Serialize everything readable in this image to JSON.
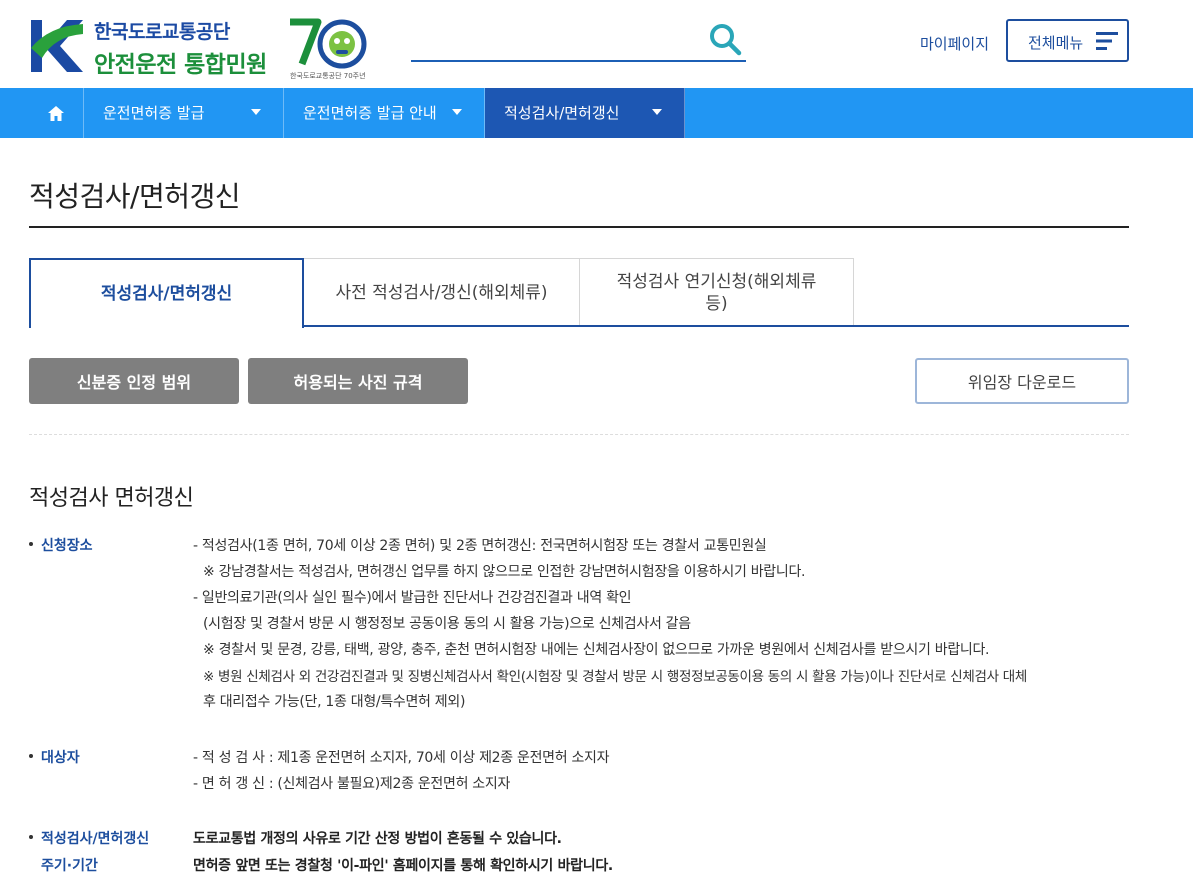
{
  "header": {
    "org_name": "한국도로교통공단",
    "site_name": "안전운전 통합민원",
    "anniversary_caption": "한국도로교통공단 70주년",
    "search_placeholder": "",
    "mypage_label": "마이페이지",
    "allmenu_label": "전체메뉴"
  },
  "nav": {
    "items": [
      {
        "label": "운전면허증 발급"
      },
      {
        "label": "운전면허증 발급 안내"
      },
      {
        "label": "적성검사/면허갱신"
      }
    ]
  },
  "page": {
    "title": "적성검사/면허갱신",
    "tabs": [
      {
        "label": "적성검사/면허갱신"
      },
      {
        "label": "사전 적성검사/갱신(해외체류)"
      },
      {
        "label_line1": "적성검사 연기신청(해외체류",
        "label_line2": "등)"
      }
    ],
    "buttons": {
      "id_scope": "신분증 인정 범위",
      "photo_spec": "허용되는 사진 규격",
      "proxy_download": "위임장 다운로드"
    }
  },
  "section": {
    "title": "적성검사 면허갱신",
    "place": {
      "label": "신청장소",
      "lines": [
        "- 적성검사(1종 면허, 70세 이상 2종 면허) 및 2종 면허갱신: 전국면허시험장 또는 경찰서 교통민원실",
        "※ 강남경찰서는 적성검사, 면허갱신 업무를 하지 않으므로 인접한 강남면허시험장을 이용하시기 바랍니다.",
        "- 일반의료기관(의사 실인 필수)에서 발급한 진단서나 건강검진결과 내역 확인",
        "(시험장 및 경찰서 방문 시 행정정보 공동이용 동의 시 활용 가능)으로 신체검사서 갈음",
        "※ 경찰서 및 문경, 강릉, 태백, 광양, 충주, 춘천 면허시험장 내에는 신체검사장이 없으므로 가까운 병원에서 신체검사를 받으시기 바랍니다.",
        "※ 병원 신체검사 외 건강검진결과 및 징병신체검사서 확인(시험장 및 경찰서 방문 시 행정정보공동이용 동의 시 활용 가능)이나 진단서로 신체검사 대체",
        "후 대리접수 가능(단, 1종 대형/특수면허 제외)"
      ]
    },
    "target": {
      "label": "대상자",
      "lines": [
        "- 적 성 검 사 : 제1종 운전면허 소지자, 70세 이상 제2종 운전면허 소지자",
        "- 면 허 갱 신 : (신체검사 불필요)제2종 운전면허 소지자"
      ]
    },
    "period": {
      "label_line1": "적성검사/면허갱신",
      "label_line2": "주기·기간",
      "lines": [
        "도로교통법 개정의 사유로 기간 산정 방법이 혼동될 수 있습니다.",
        "면허증 앞면 또는 경찰청 '이-파인' 홈페이지를 통해 확인하시기 바랍니다."
      ]
    }
  },
  "colors": {
    "nav_bg": "#2196f3",
    "nav_active": "#1d57b3",
    "brand_blue": "#1d4e9e",
    "brand_green": "#1c8f3b",
    "gray_button": "#7f7f7f"
  },
  "icons": {
    "search": "search-icon",
    "home": "home-icon",
    "menu": "hamburger-icon"
  }
}
